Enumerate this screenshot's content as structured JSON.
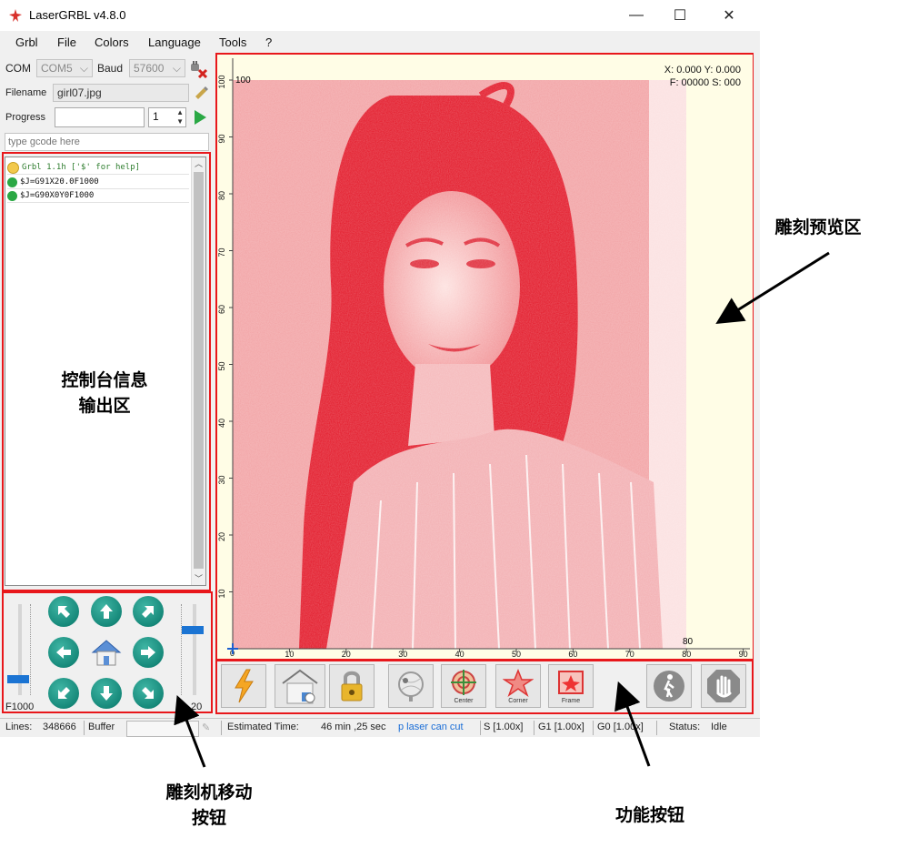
{
  "window": {
    "title": "LaserGRBL v4.8.0",
    "controls": {
      "minimize": "—",
      "maximize": "☐",
      "close": "✕"
    }
  },
  "menu": [
    "Grbl",
    "File",
    "Colors",
    "Language",
    "Tools",
    "?"
  ],
  "connection": {
    "com_label": "COM",
    "com_value": "COM5",
    "baud_label": "Baud",
    "baud_value": "57600",
    "filename_label": "Filename",
    "filename_value": "girl07.jpg",
    "progress_label": "Progress",
    "copies_value": "1",
    "gcode_placeholder": "type gcode here"
  },
  "console": {
    "lines": [
      {
        "text": "Grbl 1.1h ['$' for help]",
        "status": "info"
      },
      {
        "text": "$J=G91X20.0F1000",
        "status": "ok"
      },
      {
        "text": "$J=G90X0Y0F1000",
        "status": "ok"
      }
    ]
  },
  "jog": {
    "feed_label": "F1000",
    "step_label": "20",
    "feed_slider_level": 0.18,
    "step_slider_level": 0.72
  },
  "preview": {
    "coords_line1": "X: 0.000 Y: 0.000",
    "coords_line2": "F: 00000 S: 000",
    "y_axis_ticks": [
      "100",
      "90",
      "80",
      "70",
      "60",
      "50",
      "40",
      "30",
      "20",
      "10"
    ],
    "x_axis_ticks": [
      "10",
      "20",
      "30",
      "40",
      "50",
      "60",
      "70",
      "80",
      "90"
    ],
    "corner_y_label": "100",
    "corner_x_label": "80",
    "origin_label": "0",
    "end_label": "9"
  },
  "toolbar": {
    "buttons": [
      {
        "name": "run-button",
        "caption": ""
      },
      {
        "name": "homing-button",
        "caption": ""
      },
      {
        "name": "unlock-button",
        "caption": ""
      },
      {
        "name": "goto-origin-button",
        "caption": ""
      },
      {
        "name": "center-button",
        "caption": "Center"
      },
      {
        "name": "corner-button",
        "caption": "Corner"
      },
      {
        "name": "frame-button",
        "caption": "Frame"
      },
      {
        "name": "walk-button",
        "caption": ""
      },
      {
        "name": "stop-button",
        "caption": ""
      }
    ]
  },
  "statusbar": {
    "lines_label": "Lines:",
    "lines_value": "348666",
    "buffer_label": "Buffer",
    "estimated_label": "Estimated Time:",
    "estimated_value": "46 min ,25 sec",
    "hint": "p laser can cut",
    "s_override": "S [1.00x]",
    "g1_override": "G1 [1.00x]",
    "g0_override": "G0 [1.00x]",
    "status_label": "Status:",
    "status_value": "Idle"
  },
  "annotations": {
    "preview_area": "雕刻预览区",
    "console_area_line1": "控制台信息",
    "console_area_line2": "输出区",
    "jog_area_line1": "雕刻机移动",
    "jog_area_line2": "按钮",
    "function_area": "功能按钮"
  },
  "colors": {
    "highlight_red": "#e8171b",
    "engrave_red": "#e8263a",
    "preview_bg": "#fffde6"
  }
}
